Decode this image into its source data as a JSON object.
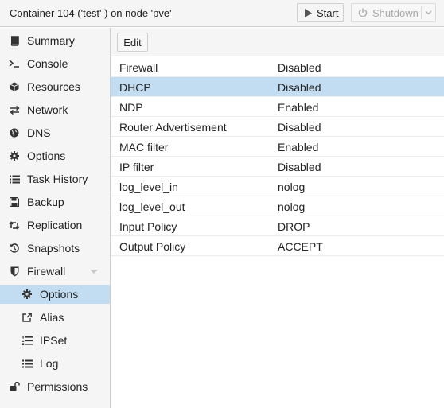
{
  "header": {
    "title": "Container 104 ('test' ) on node 'pve'",
    "start_label": "Start",
    "shutdown_label": "Shutdown"
  },
  "sidebar": {
    "items": [
      {
        "label": "Summary",
        "icon": "book-icon"
      },
      {
        "label": "Console",
        "icon": "terminal-icon"
      },
      {
        "label": "Resources",
        "icon": "cube-icon"
      },
      {
        "label": "Network",
        "icon": "exchange-icon"
      },
      {
        "label": "DNS",
        "icon": "globe-icon"
      },
      {
        "label": "Options",
        "icon": "gear-icon"
      },
      {
        "label": "Task History",
        "icon": "list-icon"
      },
      {
        "label": "Backup",
        "icon": "floppy-icon"
      },
      {
        "label": "Replication",
        "icon": "retweet-icon"
      },
      {
        "label": "Snapshots",
        "icon": "history-icon"
      },
      {
        "label": "Firewall",
        "icon": "shield-icon"
      },
      {
        "label": "Options",
        "icon": "gear-icon",
        "sub": true,
        "selected": true
      },
      {
        "label": "Alias",
        "icon": "external-link-icon",
        "sub": true
      },
      {
        "label": "IPSet",
        "icon": "list-ol-icon",
        "sub": true
      },
      {
        "label": "Log",
        "icon": "list-icon",
        "sub": true
      },
      {
        "label": "Permissions",
        "icon": "unlock-icon"
      }
    ]
  },
  "toolbar": {
    "edit_label": "Edit"
  },
  "options": {
    "rows": [
      {
        "key": "Firewall",
        "value": "Disabled"
      },
      {
        "key": "DHCP",
        "value": "Disabled",
        "selected": true
      },
      {
        "key": "NDP",
        "value": "Enabled"
      },
      {
        "key": "Router Advertisement",
        "value": "Disabled"
      },
      {
        "key": "MAC filter",
        "value": "Enabled"
      },
      {
        "key": "IP filter",
        "value": "Disabled"
      },
      {
        "key": "log_level_in",
        "value": "nolog"
      },
      {
        "key": "log_level_out",
        "value": "nolog"
      },
      {
        "key": "Input Policy",
        "value": "DROP"
      },
      {
        "key": "Output Policy",
        "value": "ACCEPT"
      }
    ]
  },
  "colors": {
    "selection": "#c2ddf2",
    "panel_bg": "#f5f5f5",
    "border": "#cfcfcf"
  }
}
